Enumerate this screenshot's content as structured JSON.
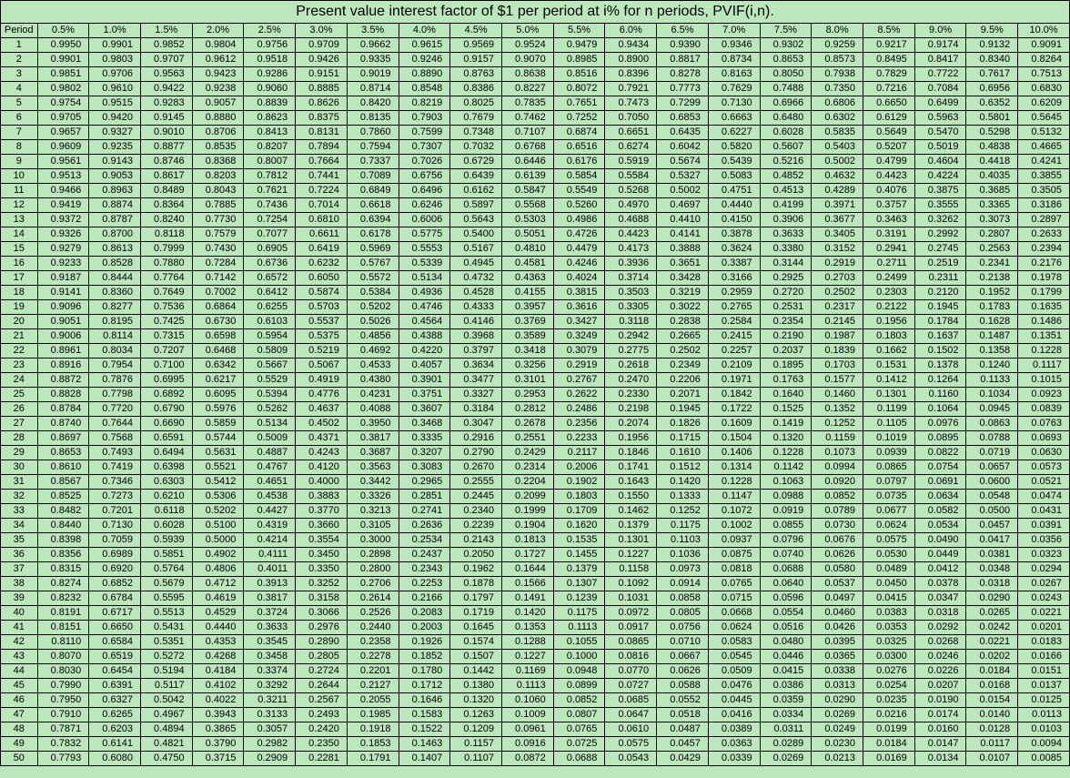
{
  "title": "Present value interest factor of $1 per period at i% for n periods, PVIF(i,n).",
  "period_header": "Period",
  "chart_data": {
    "type": "table",
    "rates": [
      "0.5%",
      "1.0%",
      "1.5%",
      "2.0%",
      "2.5%",
      "3.0%",
      "3.5%",
      "4.0%",
      "4.5%",
      "5.0%",
      "5.5%",
      "6.0%",
      "6.5%",
      "7.0%",
      "7.5%",
      "8.0%",
      "8.5%",
      "9.0%",
      "9.5%",
      "10.0%"
    ],
    "periods": [
      1,
      2,
      3,
      4,
      5,
      6,
      7,
      8,
      9,
      10,
      11,
      12,
      13,
      14,
      15,
      16,
      17,
      18,
      19,
      20,
      21,
      22,
      23,
      24,
      25,
      26,
      27,
      28,
      29,
      30,
      31,
      32,
      33,
      34,
      35,
      36,
      37,
      38,
      39,
      40,
      41,
      42,
      43,
      44,
      45,
      46,
      47,
      48,
      49,
      50
    ],
    "values": [
      [
        "0.9950",
        "0.9901",
        "0.9852",
        "0.9804",
        "0.9756",
        "0.9709",
        "0.9662",
        "0.9615",
        "0.9569",
        "0.9524",
        "0.9479",
        "0.9434",
        "0.9390",
        "0.9346",
        "0.9302",
        "0.9259",
        "0.9217",
        "0.9174",
        "0.9132",
        "0.9091"
      ],
      [
        "0.9901",
        "0.9803",
        "0.9707",
        "0.9612",
        "0.9518",
        "0.9426",
        "0.9335",
        "0.9246",
        "0.9157",
        "0.9070",
        "0.8985",
        "0.8900",
        "0.8817",
        "0.8734",
        "0.8653",
        "0.8573",
        "0.8495",
        "0.8417",
        "0.8340",
        "0.8264"
      ],
      [
        "0.9851",
        "0.9706",
        "0.9563",
        "0.9423",
        "0.9286",
        "0.9151",
        "0.9019",
        "0.8890",
        "0.8763",
        "0.8638",
        "0.8516",
        "0.8396",
        "0.8278",
        "0.8163",
        "0.8050",
        "0.7938",
        "0.7829",
        "0.7722",
        "0.7617",
        "0.7513"
      ],
      [
        "0.9802",
        "0.9610",
        "0.9422",
        "0.9238",
        "0.9060",
        "0.8885",
        "0.8714",
        "0.8548",
        "0.8386",
        "0.8227",
        "0.8072",
        "0.7921",
        "0.7773",
        "0.7629",
        "0.7488",
        "0.7350",
        "0.7216",
        "0.7084",
        "0.6956",
        "0.6830"
      ],
      [
        "0.9754",
        "0.9515",
        "0.9283",
        "0.9057",
        "0.8839",
        "0.8626",
        "0.8420",
        "0.8219",
        "0.8025",
        "0.7835",
        "0.7651",
        "0.7473",
        "0.7299",
        "0.7130",
        "0.6966",
        "0.6806",
        "0.6650",
        "0.6499",
        "0.6352",
        "0.6209"
      ],
      [
        "0.9705",
        "0.9420",
        "0.9145",
        "0.8880",
        "0.8623",
        "0.8375",
        "0.8135",
        "0.7903",
        "0.7679",
        "0.7462",
        "0.7252",
        "0.7050",
        "0.6853",
        "0.6663",
        "0.6480",
        "0.6302",
        "0.6129",
        "0.5963",
        "0.5801",
        "0.5645"
      ],
      [
        "0.9657",
        "0.9327",
        "0.9010",
        "0.8706",
        "0.8413",
        "0.8131",
        "0.7860",
        "0.7599",
        "0.7348",
        "0.7107",
        "0.6874",
        "0.6651",
        "0.6435",
        "0.6227",
        "0.6028",
        "0.5835",
        "0.5649",
        "0.5470",
        "0.5298",
        "0.5132"
      ],
      [
        "0.9609",
        "0.9235",
        "0.8877",
        "0.8535",
        "0.8207",
        "0.7894",
        "0.7594",
        "0.7307",
        "0.7032",
        "0.6768",
        "0.6516",
        "0.6274",
        "0.6042",
        "0.5820",
        "0.5607",
        "0.5403",
        "0.5207",
        "0.5019",
        "0.4838",
        "0.4665"
      ],
      [
        "0.9561",
        "0.9143",
        "0.8746",
        "0.8368",
        "0.8007",
        "0.7664",
        "0.7337",
        "0.7026",
        "0.6729",
        "0.6446",
        "0.6176",
        "0.5919",
        "0.5674",
        "0.5439",
        "0.5216",
        "0.5002",
        "0.4799",
        "0.4604",
        "0.4418",
        "0.4241"
      ],
      [
        "0.9513",
        "0.9053",
        "0.8617",
        "0.8203",
        "0.7812",
        "0.7441",
        "0.7089",
        "0.6756",
        "0.6439",
        "0.6139",
        "0.5854",
        "0.5584",
        "0.5327",
        "0.5083",
        "0.4852",
        "0.4632",
        "0.4423",
        "0.4224",
        "0.4035",
        "0.3855"
      ],
      [
        "0.9466",
        "0.8963",
        "0.8489",
        "0.8043",
        "0.7621",
        "0.7224",
        "0.6849",
        "0.6496",
        "0.6162",
        "0.5847",
        "0.5549",
        "0.5268",
        "0.5002",
        "0.4751",
        "0.4513",
        "0.4289",
        "0.4076",
        "0.3875",
        "0.3685",
        "0.3505"
      ],
      [
        "0.9419",
        "0.8874",
        "0.8364",
        "0.7885",
        "0.7436",
        "0.7014",
        "0.6618",
        "0.6246",
        "0.5897",
        "0.5568",
        "0.5260",
        "0.4970",
        "0.4697",
        "0.4440",
        "0.4199",
        "0.3971",
        "0.3757",
        "0.3555",
        "0.3365",
        "0.3186"
      ],
      [
        "0.9372",
        "0.8787",
        "0.8240",
        "0.7730",
        "0.7254",
        "0.6810",
        "0.6394",
        "0.6006",
        "0.5643",
        "0.5303",
        "0.4986",
        "0.4688",
        "0.4410",
        "0.4150",
        "0.3906",
        "0.3677",
        "0.3463",
        "0.3262",
        "0.3073",
        "0.2897"
      ],
      [
        "0.9326",
        "0.8700",
        "0.8118",
        "0.7579",
        "0.7077",
        "0.6611",
        "0.6178",
        "0.5775",
        "0.5400",
        "0.5051",
        "0.4726",
        "0.4423",
        "0.4141",
        "0.3878",
        "0.3633",
        "0.3405",
        "0.3191",
        "0.2992",
        "0.2807",
        "0.2633"
      ],
      [
        "0.9279",
        "0.8613",
        "0.7999",
        "0.7430",
        "0.6905",
        "0.6419",
        "0.5969",
        "0.5553",
        "0.5167",
        "0.4810",
        "0.4479",
        "0.4173",
        "0.3888",
        "0.3624",
        "0.3380",
        "0.3152",
        "0.2941",
        "0.2745",
        "0.2563",
        "0.2394"
      ],
      [
        "0.9233",
        "0.8528",
        "0.7880",
        "0.7284",
        "0.6736",
        "0.6232",
        "0.5767",
        "0.5339",
        "0.4945",
        "0.4581",
        "0.4246",
        "0.3936",
        "0.3651",
        "0.3387",
        "0.3144",
        "0.2919",
        "0.2711",
        "0.2519",
        "0.2341",
        "0.2176"
      ],
      [
        "0.9187",
        "0.8444",
        "0.7764",
        "0.7142",
        "0.6572",
        "0.6050",
        "0.5572",
        "0.5134",
        "0.4732",
        "0.4363",
        "0.4024",
        "0.3714",
        "0.3428",
        "0.3166",
        "0.2925",
        "0.2703",
        "0.2499",
        "0.2311",
        "0.2138",
        "0.1978"
      ],
      [
        "0.9141",
        "0.8360",
        "0.7649",
        "0.7002",
        "0.6412",
        "0.5874",
        "0.5384",
        "0.4936",
        "0.4528",
        "0.4155",
        "0.3815",
        "0.3503",
        "0.3219",
        "0.2959",
        "0.2720",
        "0.2502",
        "0.2303",
        "0.2120",
        "0.1952",
        "0.1799"
      ],
      [
        "0.9096",
        "0.8277",
        "0.7536",
        "0.6864",
        "0.6255",
        "0.5703",
        "0.5202",
        "0.4746",
        "0.4333",
        "0.3957",
        "0.3616",
        "0.3305",
        "0.3022",
        "0.2765",
        "0.2531",
        "0.2317",
        "0.2122",
        "0.1945",
        "0.1783",
        "0.1635"
      ],
      [
        "0.9051",
        "0.8195",
        "0.7425",
        "0.6730",
        "0.6103",
        "0.5537",
        "0.5026",
        "0.4564",
        "0.4146",
        "0.3769",
        "0.3427",
        "0.3118",
        "0.2838",
        "0.2584",
        "0.2354",
        "0.2145",
        "0.1956",
        "0.1784",
        "0.1628",
        "0.1486"
      ],
      [
        "0.9006",
        "0.8114",
        "0.7315",
        "0.6598",
        "0.5954",
        "0.5375",
        "0.4856",
        "0.4388",
        "0.3968",
        "0.3589",
        "0.3249",
        "0.2942",
        "0.2665",
        "0.2415",
        "0.2190",
        "0.1987",
        "0.1803",
        "0.1637",
        "0.1487",
        "0.1351"
      ],
      [
        "0.8961",
        "0.8034",
        "0.7207",
        "0.6468",
        "0.5809",
        "0.5219",
        "0.4692",
        "0.4220",
        "0.3797",
        "0.3418",
        "0.3079",
        "0.2775",
        "0.2502",
        "0.2257",
        "0.2037",
        "0.1839",
        "0.1662",
        "0.1502",
        "0.1358",
        "0.1228"
      ],
      [
        "0.8916",
        "0.7954",
        "0.7100",
        "0.6342",
        "0.5667",
        "0.5067",
        "0.4533",
        "0.4057",
        "0.3634",
        "0.3256",
        "0.2919",
        "0.2618",
        "0.2349",
        "0.2109",
        "0.1895",
        "0.1703",
        "0.1531",
        "0.1378",
        "0.1240",
        "0.1117"
      ],
      [
        "0.8872",
        "0.7876",
        "0.6995",
        "0.6217",
        "0.5529",
        "0.4919",
        "0.4380",
        "0.3901",
        "0.3477",
        "0.3101",
        "0.2767",
        "0.2470",
        "0.2206",
        "0.1971",
        "0.1763",
        "0.1577",
        "0.1412",
        "0.1264",
        "0.1133",
        "0.1015"
      ],
      [
        "0.8828",
        "0.7798",
        "0.6892",
        "0.6095",
        "0.5394",
        "0.4776",
        "0.4231",
        "0.3751",
        "0.3327",
        "0.2953",
        "0.2622",
        "0.2330",
        "0.2071",
        "0.1842",
        "0.1640",
        "0.1460",
        "0.1301",
        "0.1160",
        "0.1034",
        "0.0923"
      ],
      [
        "0.8784",
        "0.7720",
        "0.6790",
        "0.5976",
        "0.5262",
        "0.4637",
        "0.4088",
        "0.3607",
        "0.3184",
        "0.2812",
        "0.2486",
        "0.2198",
        "0.1945",
        "0.1722",
        "0.1525",
        "0.1352",
        "0.1199",
        "0.1064",
        "0.0945",
        "0.0839"
      ],
      [
        "0.8740",
        "0.7644",
        "0.6690",
        "0.5859",
        "0.5134",
        "0.4502",
        "0.3950",
        "0.3468",
        "0.3047",
        "0.2678",
        "0.2356",
        "0.2074",
        "0.1826",
        "0.1609",
        "0.1419",
        "0.1252",
        "0.1105",
        "0.0976",
        "0.0863",
        "0.0763"
      ],
      [
        "0.8697",
        "0.7568",
        "0.6591",
        "0.5744",
        "0.5009",
        "0.4371",
        "0.3817",
        "0.3335",
        "0.2916",
        "0.2551",
        "0.2233",
        "0.1956",
        "0.1715",
        "0.1504",
        "0.1320",
        "0.1159",
        "0.1019",
        "0.0895",
        "0.0788",
        "0.0693"
      ],
      [
        "0.8653",
        "0.7493",
        "0.6494",
        "0.5631",
        "0.4887",
        "0.4243",
        "0.3687",
        "0.3207",
        "0.2790",
        "0.2429",
        "0.2117",
        "0.1846",
        "0.1610",
        "0.1406",
        "0.1228",
        "0.1073",
        "0.0939",
        "0.0822",
        "0.0719",
        "0.0630"
      ],
      [
        "0.8610",
        "0.7419",
        "0.6398",
        "0.5521",
        "0.4767",
        "0.4120",
        "0.3563",
        "0.3083",
        "0.2670",
        "0.2314",
        "0.2006",
        "0.1741",
        "0.1512",
        "0.1314",
        "0.1142",
        "0.0994",
        "0.0865",
        "0.0754",
        "0.0657",
        "0.0573"
      ],
      [
        "0.8567",
        "0.7346",
        "0.6303",
        "0.5412",
        "0.4651",
        "0.4000",
        "0.3442",
        "0.2965",
        "0.2555",
        "0.2204",
        "0.1902",
        "0.1643",
        "0.1420",
        "0.1228",
        "0.1063",
        "0.0920",
        "0.0797",
        "0.0691",
        "0.0600",
        "0.0521"
      ],
      [
        "0.8525",
        "0.7273",
        "0.6210",
        "0.5306",
        "0.4538",
        "0.3883",
        "0.3326",
        "0.2851",
        "0.2445",
        "0.2099",
        "0.1803",
        "0.1550",
        "0.1333",
        "0.1147",
        "0.0988",
        "0.0852",
        "0.0735",
        "0.0634",
        "0.0548",
        "0.0474"
      ],
      [
        "0.8482",
        "0.7201",
        "0.6118",
        "0.5202",
        "0.4427",
        "0.3770",
        "0.3213",
        "0.2741",
        "0.2340",
        "0.1999",
        "0.1709",
        "0.1462",
        "0.1252",
        "0.1072",
        "0.0919",
        "0.0789",
        "0.0677",
        "0.0582",
        "0.0500",
        "0.0431"
      ],
      [
        "0.8440",
        "0.7130",
        "0.6028",
        "0.5100",
        "0.4319",
        "0.3660",
        "0.3105",
        "0.2636",
        "0.2239",
        "0.1904",
        "0.1620",
        "0.1379",
        "0.1175",
        "0.1002",
        "0.0855",
        "0.0730",
        "0.0624",
        "0.0534",
        "0.0457",
        "0.0391"
      ],
      [
        "0.8398",
        "0.7059",
        "0.5939",
        "0.5000",
        "0.4214",
        "0.3554",
        "0.3000",
        "0.2534",
        "0.2143",
        "0.1813",
        "0.1535",
        "0.1301",
        "0.1103",
        "0.0937",
        "0.0796",
        "0.0676",
        "0.0575",
        "0.0490",
        "0.0417",
        "0.0356"
      ],
      [
        "0.8356",
        "0.6989",
        "0.5851",
        "0.4902",
        "0.4111",
        "0.3450",
        "0.2898",
        "0.2437",
        "0.2050",
        "0.1727",
        "0.1455",
        "0.1227",
        "0.1036",
        "0.0875",
        "0.0740",
        "0.0626",
        "0.0530",
        "0.0449",
        "0.0381",
        "0.0323"
      ],
      [
        "0.8315",
        "0.6920",
        "0.5764",
        "0.4806",
        "0.4011",
        "0.3350",
        "0.2800",
        "0.2343",
        "0.1962",
        "0.1644",
        "0.1379",
        "0.1158",
        "0.0973",
        "0.0818",
        "0.0688",
        "0.0580",
        "0.0489",
        "0.0412",
        "0.0348",
        "0.0294"
      ],
      [
        "0.8274",
        "0.6852",
        "0.5679",
        "0.4712",
        "0.3913",
        "0.3252",
        "0.2706",
        "0.2253",
        "0.1878",
        "0.1566",
        "0.1307",
        "0.1092",
        "0.0914",
        "0.0765",
        "0.0640",
        "0.0537",
        "0.0450",
        "0.0378",
        "0.0318",
        "0.0267"
      ],
      [
        "0.8232",
        "0.6784",
        "0.5595",
        "0.4619",
        "0.3817",
        "0.3158",
        "0.2614",
        "0.2166",
        "0.1797",
        "0.1491",
        "0.1239",
        "0.1031",
        "0.0858",
        "0.0715",
        "0.0596",
        "0.0497",
        "0.0415",
        "0.0347",
        "0.0290",
        "0.0243"
      ],
      [
        "0.8191",
        "0.6717",
        "0.5513",
        "0.4529",
        "0.3724",
        "0.3066",
        "0.2526",
        "0.2083",
        "0.1719",
        "0.1420",
        "0.1175",
        "0.0972",
        "0.0805",
        "0.0668",
        "0.0554",
        "0.0460",
        "0.0383",
        "0.0318",
        "0.0265",
        "0.0221"
      ],
      [
        "0.8151",
        "0.6650",
        "0.5431",
        "0.4440",
        "0.3633",
        "0.2976",
        "0.2440",
        "0.2003",
        "0.1645",
        "0.1353",
        "0.1113",
        "0.0917",
        "0.0756",
        "0.0624",
        "0.0516",
        "0.0426",
        "0.0353",
        "0.0292",
        "0.0242",
        "0.0201"
      ],
      [
        "0.8110",
        "0.6584",
        "0.5351",
        "0.4353",
        "0.3545",
        "0.2890",
        "0.2358",
        "0.1926",
        "0.1574",
        "0.1288",
        "0.1055",
        "0.0865",
        "0.0710",
        "0.0583",
        "0.0480",
        "0.0395",
        "0.0325",
        "0.0268",
        "0.0221",
        "0.0183"
      ],
      [
        "0.8070",
        "0.6519",
        "0.5272",
        "0.4268",
        "0.3458",
        "0.2805",
        "0.2278",
        "0.1852",
        "0.1507",
        "0.1227",
        "0.1000",
        "0.0816",
        "0.0667",
        "0.0545",
        "0.0446",
        "0.0365",
        "0.0300",
        "0.0246",
        "0.0202",
        "0.0166"
      ],
      [
        "0.8030",
        "0.6454",
        "0.5194",
        "0.4184",
        "0.3374",
        "0.2724",
        "0.2201",
        "0.1780",
        "0.1442",
        "0.1169",
        "0.0948",
        "0.0770",
        "0.0626",
        "0.0509",
        "0.0415",
        "0.0338",
        "0.0276",
        "0.0226",
        "0.0184",
        "0.0151"
      ],
      [
        "0.7990",
        "0.6391",
        "0.5117",
        "0.4102",
        "0.3292",
        "0.2644",
        "0.2127",
        "0.1712",
        "0.1380",
        "0.1113",
        "0.0899",
        "0.0727",
        "0.0588",
        "0.0476",
        "0.0386",
        "0.0313",
        "0.0254",
        "0.0207",
        "0.0168",
        "0.0137"
      ],
      [
        "0.7950",
        "0.6327",
        "0.5042",
        "0.4022",
        "0.3211",
        "0.2567",
        "0.2055",
        "0.1646",
        "0.1320",
        "0.1060",
        "0.0852",
        "0.0685",
        "0.0552",
        "0.0445",
        "0.0359",
        "0.0290",
        "0.0235",
        "0.0190",
        "0.0154",
        "0.0125"
      ],
      [
        "0.7910",
        "0.6265",
        "0.4967",
        "0.3943",
        "0.3133",
        "0.2493",
        "0.1985",
        "0.1583",
        "0.1263",
        "0.1009",
        "0.0807",
        "0.0647",
        "0.0518",
        "0.0416",
        "0.0334",
        "0.0269",
        "0.0216",
        "0.0174",
        "0.0140",
        "0.0113"
      ],
      [
        "0.7871",
        "0.6203",
        "0.4894",
        "0.3865",
        "0.3057",
        "0.2420",
        "0.1918",
        "0.1522",
        "0.1209",
        "0.0961",
        "0.0765",
        "0.0610",
        "0.0487",
        "0.0389",
        "0.0311",
        "0.0249",
        "0.0199",
        "0.0160",
        "0.0128",
        "0.0103"
      ],
      [
        "0.7832",
        "0.6141",
        "0.4821",
        "0.3790",
        "0.2982",
        "0.2350",
        "0.1853",
        "0.1463",
        "0.1157",
        "0.0916",
        "0.0725",
        "0.0575",
        "0.0457",
        "0.0363",
        "0.0289",
        "0.0230",
        "0.0184",
        "0.0147",
        "0.0117",
        "0.0094"
      ],
      [
        "0.7793",
        "0.6080",
        "0.4750",
        "0.3715",
        "0.2909",
        "0.2281",
        "0.1791",
        "0.1407",
        "0.1107",
        "0.0872",
        "0.0688",
        "0.0543",
        "0.0429",
        "0.0339",
        "0.0269",
        "0.0213",
        "0.0169",
        "0.0134",
        "0.0107",
        "0.0085"
      ]
    ]
  }
}
